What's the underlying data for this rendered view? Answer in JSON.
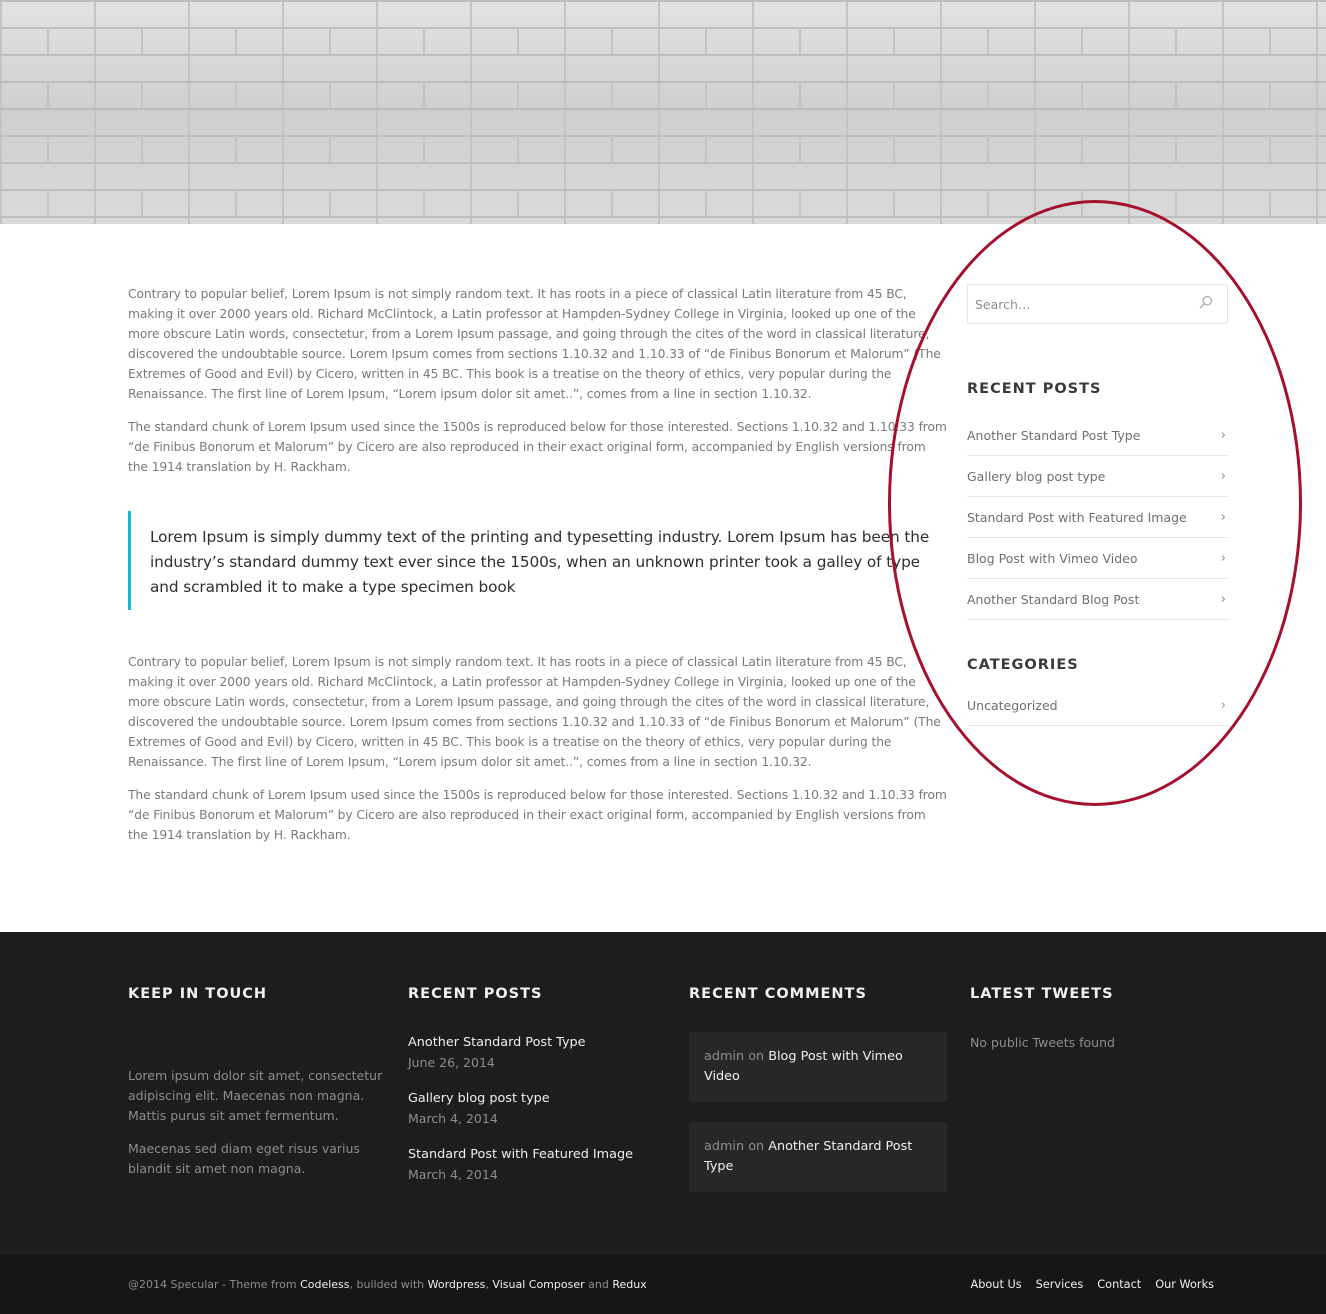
{
  "main": {
    "paragraphs_top": [
      "Contrary to popular belief, Lorem Ipsum is not simply random text. It has roots in a piece of classical Latin literature from 45 BC, making it over 2000 years old. Richard McClintock, a Latin professor at Hampden-Sydney College in Virginia, looked up one of the more obscure Latin words, consectetur, from a Lorem Ipsum passage, and going through the cites of the word in classical literature, discovered the undoubtable source. Lorem Ipsum comes from sections 1.10.32 and 1.10.33 of “de Finibus Bonorum et Malorum” (The Extremes of Good and Evil) by Cicero, written in 45 BC. This book is a treatise on the theory of ethics, very popular during the Renaissance. The first line of Lorem Ipsum, “Lorem ipsum dolor sit amet..”, comes from a line in section 1.10.32.",
      "The standard chunk of Lorem Ipsum used since the 1500s is reproduced below for those interested. Sections 1.10.32 and 1.10.33 from “de Finibus Bonorum et Malorum” by Cicero are also reproduced in their exact original form, accompanied by English versions from the 1914 translation by H. Rackham."
    ],
    "blockquote": "Lorem Ipsum is simply dummy text of the printing and typesetting industry. Lorem Ipsum has been the industry’s standard dummy text ever since the 1500s, when an unknown printer took a galley of type and scrambled it to make a type specimen book",
    "paragraphs_bottom": [
      "Contrary to popular belief, Lorem Ipsum is not simply random text. It has roots in a piece of classical Latin literature from 45 BC, making it over 2000 years old. Richard McClintock, a Latin professor at Hampden-Sydney College in Virginia, looked up one of the more obscure Latin words, consectetur, from a Lorem Ipsum passage, and going through the cites of the word in classical literature, discovered the undoubtable source. Lorem Ipsum comes from sections 1.10.32 and 1.10.33 of “de Finibus Bonorum et Malorum” (The Extremes of Good and Evil) by Cicero, written in 45 BC. This book is a treatise on the theory of ethics, very popular during the Renaissance. The first line of Lorem Ipsum, “Lorem ipsum dolor sit amet..”, comes from a line in section 1.10.32.",
      "The standard chunk of Lorem Ipsum used since the 1500s is reproduced below for those interested. Sections 1.10.32 and 1.10.33 from “de Finibus Bonorum et Malorum” by Cicero are also reproduced in their exact original form, accompanied by English versions from the 1914 translation by H. Rackham."
    ]
  },
  "sidebar": {
    "search": {
      "placeholder": "Search…",
      "icon": "search-icon"
    },
    "recent_posts": {
      "title": "RECENT POSTS",
      "items": [
        "Another Standard Post Type",
        "Gallery blog post type",
        "Standard Post with Featured Image",
        "Blog Post with Vimeo Video",
        "Another Standard Blog Post"
      ]
    },
    "categories": {
      "title": "CATEGORIES",
      "items": [
        "Uncategorized"
      ]
    },
    "chevron": "›"
  },
  "footer": {
    "keep_in_touch": {
      "title": "KEEP IN TOUCH",
      "p1": "Lorem ipsum dolor sit amet, consectetur adipiscing elit. Maecenas non magna. Mattis purus sit amet fermentum.",
      "p2": "Maecenas sed diam eget risus varius blandit sit amet non magna."
    },
    "recent_posts": {
      "title": "RECENT POSTS",
      "items": [
        {
          "title": "Another Standard Post Type",
          "date": "June 26, 2014"
        },
        {
          "title": "Gallery blog post type",
          "date": "March 4, 2014"
        },
        {
          "title": "Standard Post with Featured Image",
          "date": "March 4, 2014"
        }
      ]
    },
    "recent_comments": {
      "title": "RECENT COMMENTS",
      "items": [
        {
          "author": "admin",
          "on": "on",
          "post": "Blog Post with Vimeo Video"
        },
        {
          "author": "admin",
          "on": "on",
          "post": "Another Standard Post Type"
        }
      ]
    },
    "latest_tweets": {
      "title": "LATEST TWEETS",
      "text": "No public Tweets found"
    }
  },
  "bottom_bar": {
    "credits_prefix": "@2014 Specular -  Theme from ",
    "codeless": "Codeless",
    "builded_with": ", builded with ",
    "wordpress": "Wordpress",
    "comma": ", ",
    "visual_composer": "Visual Composer",
    "and": " and ",
    "redux": "Redux",
    "nav": [
      "About Us",
      "Services",
      "Contact",
      "Our Works"
    ]
  },
  "colors": {
    "accent_quote_border": "#1fb6c9",
    "annotation_ellipse": "#a4102d",
    "footer_bg": "#1d1d1d",
    "bottom_bar_bg": "#161616"
  }
}
